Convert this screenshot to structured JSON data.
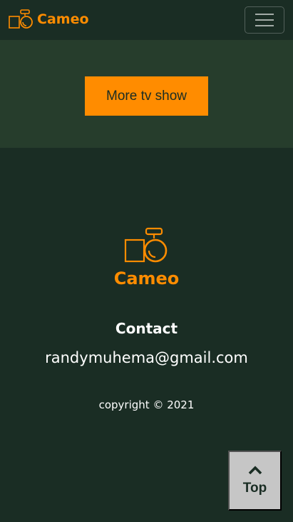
{
  "navbar": {
    "brand_name": "Cameo",
    "brand_icon": "camera-icon",
    "menu_icon": "hamburger-menu-icon"
  },
  "main": {
    "more_button_label": "More tv show"
  },
  "footer": {
    "brand_name": "Cameo",
    "logo_icon": "camera-icon",
    "contact_title": "Contact",
    "contact_email": "randymuhema@gmail.com",
    "copyright": "copyright © 2021"
  },
  "back_to_top": {
    "label": "Top",
    "icon": "chevron-up-icon"
  },
  "colors": {
    "background": "#1a2d24",
    "band": "#263d2c",
    "accent": "#ff8c00",
    "top_button": "#c6c6c6"
  }
}
